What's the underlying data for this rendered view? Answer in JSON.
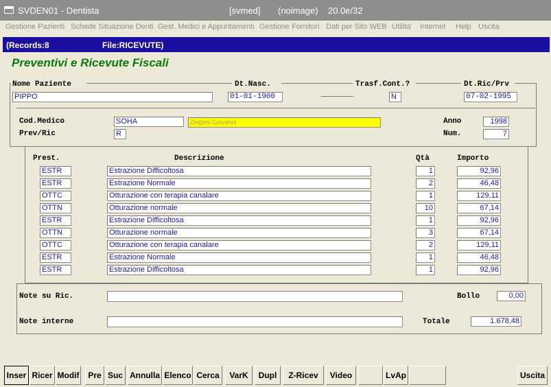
{
  "titlebar": {
    "app": "SVDEN01 - Dentista",
    "server": "[svmed]",
    "mode": "(noimage)",
    "version": "20.0e/32"
  },
  "menu": [
    "Gestione Pazienti",
    "Schede Situazione Denti",
    "Gest. Medici e Appuntamenti",
    "Gestione Fornitori",
    "Dati per Sito WEB",
    "Utilita'",
    "Internet",
    "Help",
    "Uscita"
  ],
  "header": {
    "records": "(Records:8",
    "file": "File:RICEVUTE)"
  },
  "form": {
    "title": "Preventivi e Ricevute Fiscali",
    "labels": {
      "nome_paziente": "Nome Paziente",
      "dt_nasc": "Dt.Nasc.",
      "trasf_cont": "Trasf.Cont.?",
      "dt_ric_prv": "Dt.Ric/Prv",
      "cod_medico": "Cod.Medico",
      "prev_ric": "Prev/Ric",
      "anno": "Anno",
      "num": "Num.",
      "note_ric": "Note su Ric.",
      "note_interne": "Note interne",
      "bollo": "Bollo",
      "totale": "Totale"
    },
    "values": {
      "nome_paziente": "PIPPO",
      "dt_nasc": "01-01-1900",
      "trasf_cont": "N",
      "dt_ric_prv": "07-02-1995",
      "cod_medico": "SOHA",
      "medico_nome": "Zingoni Giovanni",
      "prev_ric": "R",
      "anno": "1998",
      "num": "7",
      "note_ric": "",
      "note_interne": "",
      "bollo": "0,00",
      "totale": "1.678,48"
    }
  },
  "table": {
    "headers": {
      "prest": "Prest.",
      "descrizione": "Descrizione",
      "qta": "Qtà",
      "importo": "Importo"
    },
    "rows": [
      {
        "prest": "ESTR",
        "descrizione": "Estrazione Difficoltosa",
        "qta": "1",
        "importo": "92,96"
      },
      {
        "prest": "ESTR",
        "descrizione": "Estrazione Normale",
        "qta": "2",
        "importo": "46,48"
      },
      {
        "prest": "OTTC",
        "descrizione": "Otturazione con terapia canalare",
        "qta": "1",
        "importo": "129,11"
      },
      {
        "prest": "OTTN",
        "descrizione": "Otturazione normale",
        "qta": "10",
        "importo": "67,14"
      },
      {
        "prest": "ESTR",
        "descrizione": "Estrazione Difficoltosa",
        "qta": "1",
        "importo": "92,96"
      },
      {
        "prest": "OTTN",
        "descrizione": "Otturazione normale",
        "qta": "3",
        "importo": "67,14"
      },
      {
        "prest": "OTTC",
        "descrizione": "Otturazione con terapia canalare",
        "qta": "2",
        "importo": "129,11"
      },
      {
        "prest": "ESTR",
        "descrizione": "Estrazione Normale",
        "qta": "1",
        "importo": "46,48"
      },
      {
        "prest": "ESTR",
        "descrizione": "Estrazione Difficoltosa",
        "qta": "1",
        "importo": "92,96"
      }
    ]
  },
  "toolbar": {
    "buttons": [
      "Inser",
      "Ricer",
      "Modif",
      "Pre",
      "Suc",
      "Annulla",
      "Elenco",
      "Cerca",
      "VarK",
      "Dupl",
      "Z-Ricev",
      "Video",
      "",
      "LvAp",
      "",
      "Uscita"
    ]
  },
  "colors": {
    "title_green": "#0a7a0a",
    "header_blue": "#1a0fa0",
    "field_text": "#1a1aa0",
    "highlight_yellow": "#ffff00"
  }
}
